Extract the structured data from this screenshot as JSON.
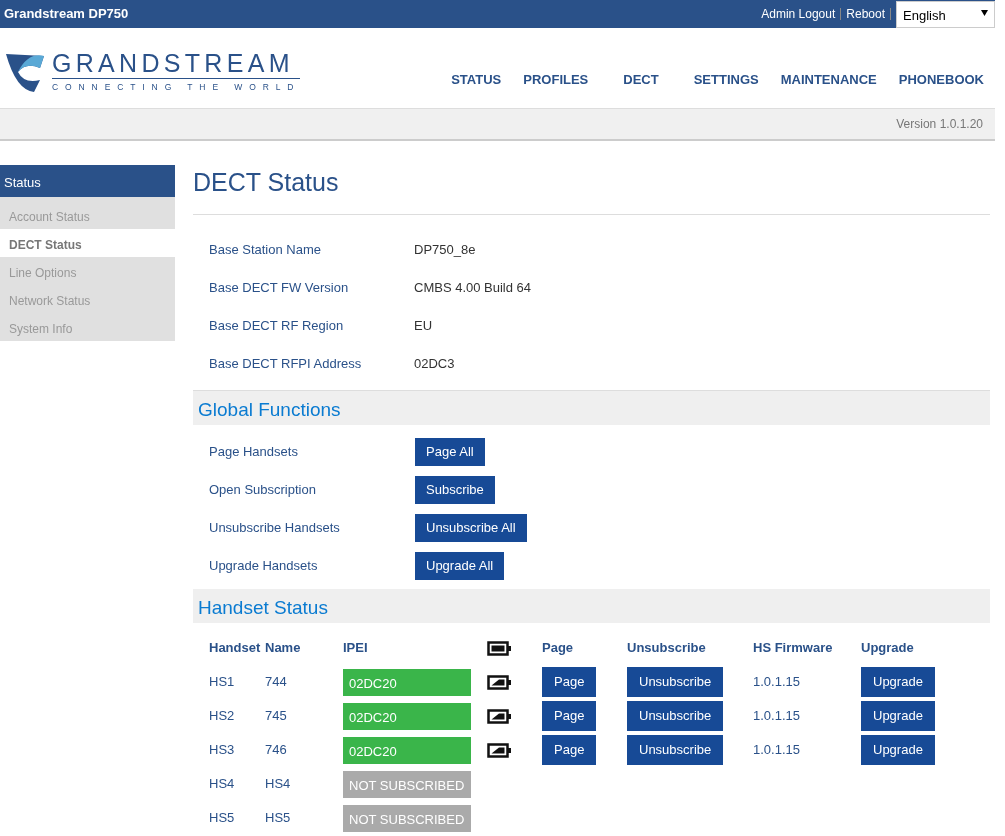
{
  "window": {
    "title": "Grandstream DP750"
  },
  "top_links": [
    "Admin Logout",
    "Reboot"
  ],
  "language": {
    "value": "English"
  },
  "logo": {
    "name": "GRANDSTREAM",
    "tagline": "CONNECTING THE WORLD"
  },
  "main_nav": [
    {
      "label": "STATUS",
      "selected": false
    },
    {
      "label": "PROFILES",
      "selected": false
    },
    {
      "label": "DECT",
      "selected": false
    },
    {
      "label": "SETTINGS",
      "selected": false
    },
    {
      "label": "MAINTENANCE",
      "selected": false
    },
    {
      "label": "PHONEBOOK",
      "selected": false
    }
  ],
  "version": "Version 1.0.1.20",
  "sidebar": {
    "title": "Status",
    "items": [
      {
        "label": "Account Status",
        "selected": false
      },
      {
        "label": "DECT Status",
        "selected": true
      },
      {
        "label": "Line Options",
        "selected": false
      },
      {
        "label": "Network Status",
        "selected": false
      },
      {
        "label": "System Info",
        "selected": false
      }
    ]
  },
  "page_title": "DECT Status",
  "info": [
    {
      "label": "Base Station Name",
      "value": "DP750_8e"
    },
    {
      "label": "Base DECT FW Version",
      "value": "CMBS 4.00 Build 64"
    },
    {
      "label": "Base DECT RF Region",
      "value": "EU"
    },
    {
      "label": "Base DECT RFPI Address",
      "value": "02DC3"
    }
  ],
  "global_functions": {
    "title": "Global Functions",
    "rows": [
      {
        "label": "Page Handsets",
        "button": "Page All"
      },
      {
        "label": "Open Subscription",
        "button": "Subscribe"
      },
      {
        "label": "Unsubscribe Handsets",
        "button": "Unsubscribe All"
      },
      {
        "label": "Upgrade Handsets",
        "button": "Upgrade All"
      }
    ]
  },
  "handset_status": {
    "title": "Handset Status",
    "columns": [
      "Handset",
      "Name",
      "IPEI",
      "Page",
      "Unsubscribe",
      "HS Firmware",
      "Upgrade"
    ],
    "rows": [
      {
        "handset": "HS1",
        "name": "744",
        "ipei": "02DC20",
        "subscribed": true,
        "page": "Page",
        "unsubscribe": "Unsubscribe",
        "firmware": "1.0.1.15",
        "upgrade": "Upgrade"
      },
      {
        "handset": "HS2",
        "name": "745",
        "ipei": "02DC20",
        "subscribed": true,
        "page": "Page",
        "unsubscribe": "Unsubscribe",
        "firmware": "1.0.1.15",
        "upgrade": "Upgrade"
      },
      {
        "handset": "HS3",
        "name": "746",
        "ipei": "02DC20",
        "subscribed": true,
        "page": "Page",
        "unsubscribe": "Unsubscribe",
        "firmware": "1.0.1.15",
        "upgrade": "Upgrade"
      },
      {
        "handset": "HS4",
        "name": "HS4",
        "ipei": "NOT SUBSCRIBED",
        "subscribed": false
      },
      {
        "handset": "HS5",
        "name": "HS5",
        "ipei": "NOT SUBSCRIBED",
        "subscribed": false
      }
    ]
  }
}
